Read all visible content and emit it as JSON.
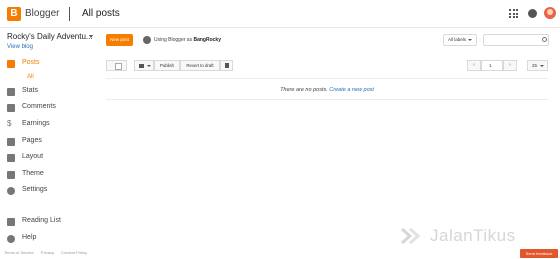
{
  "header": {
    "brand": "Blogger",
    "title": "All posts"
  },
  "sidebar": {
    "blog_title": "Rocky's Daily Adventu...",
    "view_blog": "View blog",
    "items": [
      {
        "label": "Posts",
        "icon": "posts-icon",
        "active": true
      },
      {
        "label": "Stats",
        "icon": "stats-icon"
      },
      {
        "label": "Comments",
        "icon": "comments-icon"
      },
      {
        "label": "Earnings",
        "icon": "dollar-icon"
      },
      {
        "label": "Pages",
        "icon": "pages-icon"
      },
      {
        "label": "Layout",
        "icon": "layout-icon"
      },
      {
        "label": "Theme",
        "icon": "theme-icon"
      },
      {
        "label": "Settings",
        "icon": "gear-icon"
      },
      {
        "label": "Reading List",
        "icon": "bookmark-icon"
      },
      {
        "label": "Help",
        "icon": "help-icon"
      }
    ],
    "sub_item": "All",
    "footer": [
      "Terms of Service",
      "Privacy",
      "Content Policy"
    ]
  },
  "toolbar": {
    "new_post": "New post",
    "using_prefix": "Using Blogger as ",
    "using_user": "BangRocky",
    "labels_select": "All labels",
    "search_placeholder": "",
    "publish": "Publish",
    "revert": "Revert to draft",
    "page_number": "1",
    "per_page": "25"
  },
  "main": {
    "empty_text": "There are no posts. ",
    "create_link": "Create a new post"
  },
  "watermark": "JalanTikus",
  "feedback": "Send feedback",
  "colors": {
    "accent": "#f57d00",
    "link": "#2a6ebb",
    "feedback": "#e2562b"
  }
}
